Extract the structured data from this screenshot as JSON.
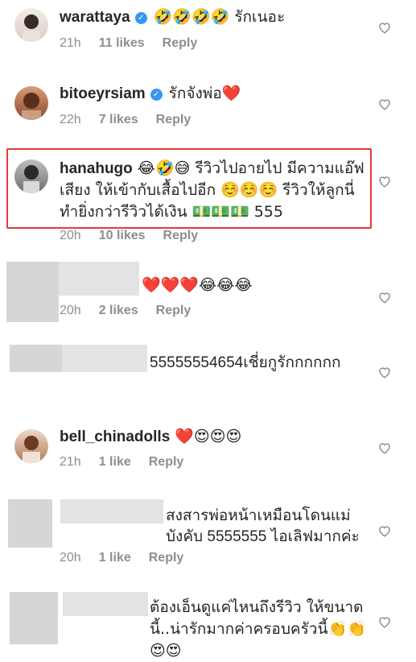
{
  "comments": [
    {
      "username": "warattaya",
      "verified": true,
      "text": "🤣🤣🤣🤣 รักเนอะ",
      "time": "21h",
      "likes": "11 likes",
      "reply": "Reply"
    },
    {
      "username": "bitoeyrsiam",
      "verified": true,
      "text": "รักจังพ่อ❤️",
      "time": "22h",
      "likes": "7 likes",
      "reply": "Reply"
    },
    {
      "username": "hanahugo",
      "verified": false,
      "text": "😂🤣😅 รีวิวไปอายไป มีความแอ๊ฟเสียง ให้เข้ากับเสื้อไปอีก ☺️☺️☺️ รีวิวให้ลูกนี่ ทำยิ่งกว่ารีวิวได้เงิน 💵💵💵 555",
      "time": "20h",
      "likes": "10 likes",
      "reply": "Reply"
    },
    {
      "username": "",
      "verified": false,
      "text": "❤️❤️❤️😂😂😂",
      "time": "20h",
      "likes": "2 likes",
      "reply": "Reply"
    },
    {
      "username": "",
      "verified": false,
      "text": "55555554654เชี่ยกูรักกกกกก",
      "time": "",
      "likes": "",
      "reply": ""
    },
    {
      "username": "bell_chinadolls",
      "verified": false,
      "text": "❤️😍😍😍",
      "time": "21h",
      "likes": "1 like",
      "reply": "Reply"
    },
    {
      "username": "",
      "verified": false,
      "text": "สงสารพ่อหน้าเหมือนโดนแม่บังคับ 5555555 ไอเลิฟมากค่ะ",
      "time": "20h",
      "likes": "1 like",
      "reply": "Reply"
    },
    {
      "username": "",
      "verified": false,
      "text": "ต้องเอ็นดูแค่ไหนถึงรีวิว ให้ขนาดนี้..น่ารักมากค่าครอบครัวนี้👏👏😍😍",
      "time": "",
      "likes": "",
      "reply": ""
    }
  ],
  "colors": {
    "highlight_border": "#e53935",
    "verified_blue": "#3897f0",
    "meta_gray": "#8e8e8e"
  },
  "icons": {
    "verified": "verified-badge-icon",
    "like": "heart-outline-icon"
  }
}
